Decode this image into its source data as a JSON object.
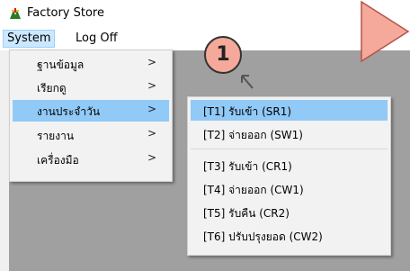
{
  "window": {
    "title": "Factory Store"
  },
  "menubar": {
    "items": [
      "System",
      "Log Off"
    ]
  },
  "system_menu": {
    "items": [
      {
        "label": "ฐานข้อมูล",
        "arrow": ">"
      },
      {
        "label": "เรียกดู",
        "arrow": ">"
      },
      {
        "label": "งานประจำวัน",
        "arrow": ">"
      },
      {
        "label": "รายงาน",
        "arrow": ">"
      },
      {
        "label": "เครื่องมือ",
        "arrow": ">"
      }
    ],
    "highlighted_index": 2
  },
  "submenu": {
    "items": [
      "[T1] รับเข้า (SR1)",
      "[T2] จ่ายออก (SW1)",
      "[T3] รับเข้า (CR1)",
      "[T4] จ่ายออก (CW1)",
      "[T5] รับคืน (CR2)",
      "[T6] ปรับปรุงยอด (CW2)"
    ],
    "highlighted_index": 0
  },
  "annotation": {
    "step_number": "1"
  },
  "colors": {
    "highlight": "#91c9f7",
    "callout": "#f5a99a",
    "workarea": "#a0a0a0"
  }
}
